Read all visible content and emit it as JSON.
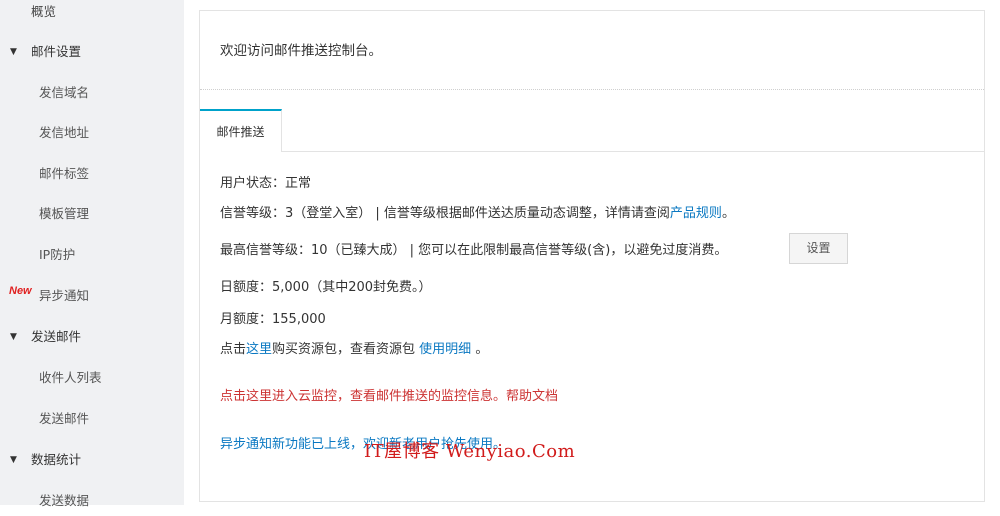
{
  "sidebar": {
    "overview": "概览",
    "mail_settings": "邮件设置",
    "sender_domain": "发信域名",
    "sender_address": "发信地址",
    "mail_tags": "邮件标签",
    "template_management": "模板管理",
    "ip_protection": "IP防护",
    "new_badge": "New",
    "async_notify": "异步通知",
    "send_mail": "发送邮件",
    "recipient_list": "收件人列表",
    "send_mail_sub": "发送邮件",
    "data_stats": "数据统计",
    "send_data": "发送数据"
  },
  "main": {
    "welcome": "欢迎访问邮件推送控制台。",
    "tab_label": "邮件推送",
    "user_status": "用户状态：正常",
    "credit_level_text": "信誉等级：3（登堂入室） | 信誉等级根据邮件送达质量动态调整，详情请查阅",
    "credit_level_link": "产品规则",
    "credit_level_end": "。",
    "max_credit_text": "最高信誉等级：10（已臻大成） | 您可以在此限制最高信誉等级(含)，以避免过度消费。",
    "settings_button": "设置",
    "daily_quota": "日额度：5,000（其中200封免费。）",
    "monthly_quota": "月额度：155,000",
    "buy_prefix": "点击",
    "buy_link": "这里",
    "buy_middle": "购买资源包，查看资源包 ",
    "usage_link": "使用明细",
    "buy_end": " 。",
    "monitor_text": "点击这里进入云监控，查看邮件推送的监控信息。帮助文档",
    "async_info": "异步通知新功能已上线，欢迎新老用户抢先使用。"
  },
  "watermark": "IT屋博客 Wenyiao.Com",
  "icons": {
    "caret": "caret-down-icon"
  },
  "colors": {
    "accent": "#00a2ca",
    "link": "#0a78c2",
    "alert": "#cc3333",
    "badge": "#e02020"
  }
}
